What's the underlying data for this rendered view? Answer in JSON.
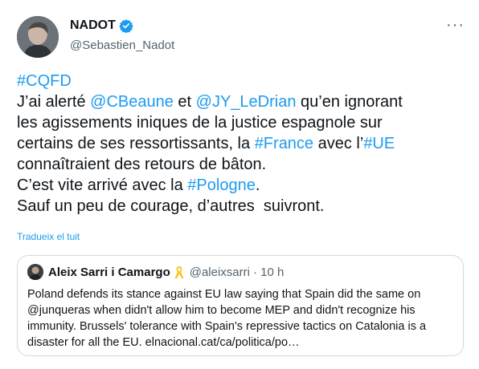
{
  "author": {
    "name": "NADOT",
    "handle": "@Sebastien_Nadot",
    "more": "···"
  },
  "tweet": {
    "segments": [
      {
        "t": "#CQFD",
        "link": true
      },
      {
        "t": "\nJ’ai alerté ",
        "link": false
      },
      {
        "t": "@CBeaune",
        "link": true
      },
      {
        "t": " et ",
        "link": false
      },
      {
        "t": "@JY_LeDrian",
        "link": true
      },
      {
        "t": " qu’en ignorant\nles agissements iniques de la justice espagnole sur\ncertains de ses ressortissants, la ",
        "link": false
      },
      {
        "t": "#France",
        "link": true
      },
      {
        "t": " avec l’",
        "link": false
      },
      {
        "t": "#UE",
        "link": true
      },
      {
        "t": "\nconnaîtraient des retours de bâton.\nC’est vite arrivé avec la ",
        "link": false
      },
      {
        "t": "#Pologne",
        "link": true
      },
      {
        "t": ".\nSauf un peu de courage, d’autres  suivront.",
        "link": false
      }
    ]
  },
  "translate_label": "Tradueix el tuit",
  "quote": {
    "name": "Aleix Sarri i Camargo",
    "handle": "@aleixsarri",
    "time": "· 10 h",
    "text": "Poland defends its stance against EU law saying that Spain did the same on @junqueras when didn't allow him to become MEP and didn't recognize his immunity. Brussels' tolerance with Spain's repressive tactics on Catalonia is a disaster for all the EU. elnacional.cat/ca/politica/po…"
  },
  "colors": {
    "link": "#1d9bf0",
    "verified": "#1d9bf0",
    "ribbon": "#f5c518"
  },
  "icons": [
    "verified-badge-icon",
    "more-options-icon",
    "yellow-ribbon-icon"
  ]
}
